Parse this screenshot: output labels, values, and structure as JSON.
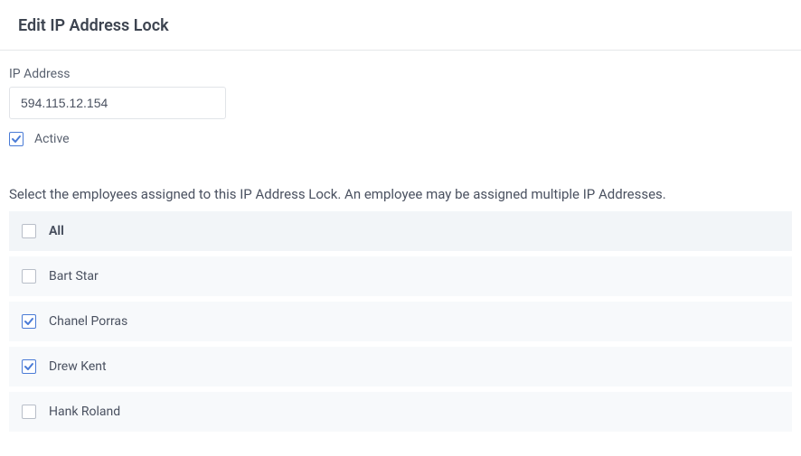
{
  "header": {
    "title": "Edit IP Address Lock"
  },
  "form": {
    "ip_label": "IP Address",
    "ip_value": "594.115.12.154",
    "active_label": "Active",
    "active_checked": true
  },
  "instruction": "Select the employees assigned to this IP Address Lock. An employee may be assigned multiple IP Addresses.",
  "employees": {
    "all_label": "All",
    "all_checked": false,
    "list": [
      {
        "name": "Bart Star",
        "checked": false
      },
      {
        "name": "Chanel Porras",
        "checked": true
      },
      {
        "name": "Drew Kent",
        "checked": true
      },
      {
        "name": "Hank Roland",
        "checked": false
      }
    ]
  }
}
